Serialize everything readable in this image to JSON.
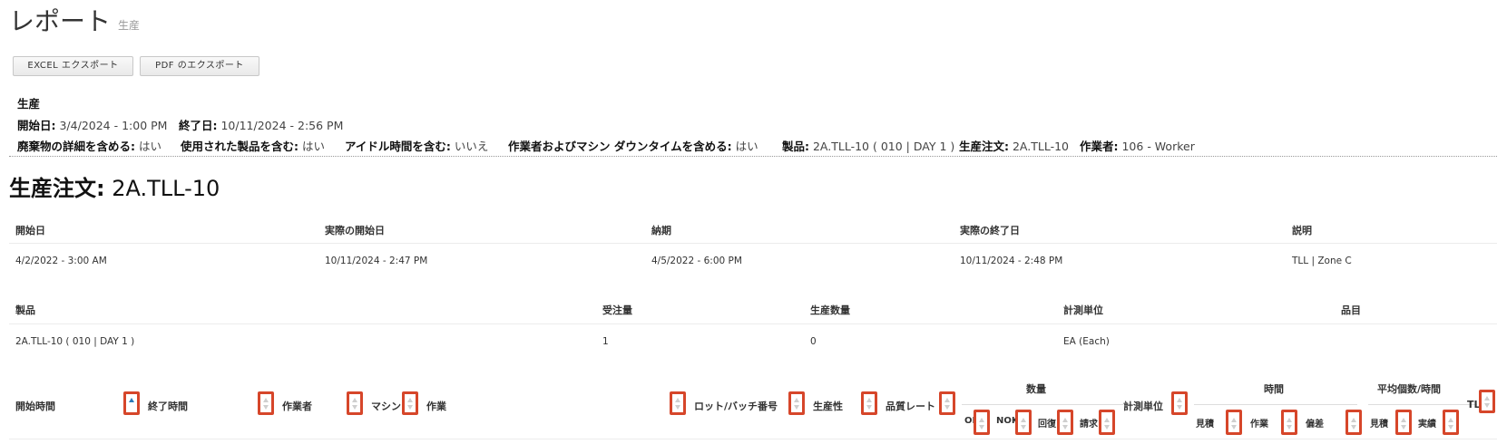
{
  "page": {
    "title": "レポート",
    "subtitle": "生産"
  },
  "actions": {
    "excel_label": "EXCEL エクスポート",
    "pdf_label": "PDF のエクスポート"
  },
  "filters": {
    "heading": "生産",
    "start_label": "開始日:",
    "start_value": "3/4/2024 - 1:00 PM",
    "end_label": "終了日:",
    "end_value": "10/11/2024 - 2:56 PM",
    "waste_label": "廃棄物の詳細を含める:",
    "waste_value": "はい",
    "used_label": "使用された製品を含む:",
    "used_value": "はい",
    "idle_label": "アイドル時間を含む:",
    "idle_value": "いいえ",
    "downtime_label": "作業者およびマシン ダウンタイムを含める:",
    "downtime_value": "はい",
    "product_label": "製品:",
    "product_value": "2A.TLL-10 ( 010 | DAY 1 )",
    "order_label": "生産注文:",
    "order_value": "2A.TLL-10",
    "worker_label": "作業者:",
    "worker_value": "106 - Worker"
  },
  "order": {
    "heading_label": "生産注文:",
    "heading_value": " 2A.TLL-10",
    "table1": {
      "headers": [
        "開始日",
        "実際の開始日",
        "納期",
        "実際の終了日",
        "説明"
      ],
      "values": [
        "4/2/2022 - 3:00 AM",
        "10/11/2024 - 2:47 PM",
        "4/5/2022 - 6:00 PM",
        "10/11/2024 - 2:48 PM",
        "TLL | Zone C"
      ]
    },
    "table2": {
      "headers": [
        "製品",
        "受注量",
        "生産数量",
        "計測単位",
        "品目"
      ],
      "values": [
        "2A.TLL-10 ( 010 | DAY 1 )",
        "1",
        "0",
        "EA (Each)",
        ""
      ]
    }
  },
  "grid": {
    "columns": {
      "start_time": "開始時間",
      "end_time": "終了時間",
      "worker": "作業者",
      "machine": "マシン",
      "operation": "作業",
      "lot": "ロット/バッチ番号",
      "productivity": "生産性",
      "quality": "品質レート",
      "uom": "計測単位",
      "tl": "TL"
    },
    "groups": {
      "quantity": "数量",
      "time": "時間",
      "avg": "平均個数/時間"
    },
    "sub": {
      "ok": "OK",
      "nok": "NOK",
      "recovery": "回復",
      "claim": "請求",
      "time_est": "見積",
      "time_work": "作業",
      "time_dev": "偏差",
      "avg_est": "見積",
      "avg_actual": "実績"
    }
  }
}
